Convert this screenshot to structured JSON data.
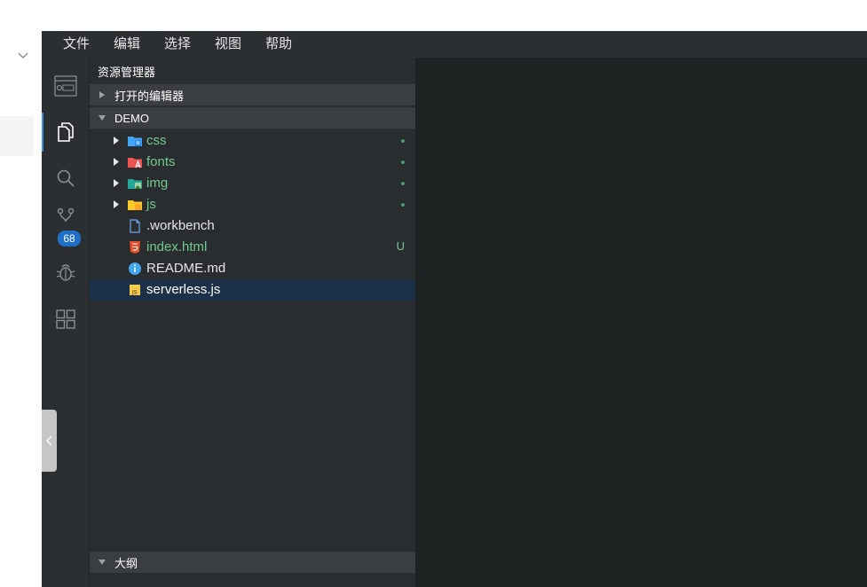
{
  "menu": [
    "文件",
    "编辑",
    "选择",
    "视图",
    "帮助"
  ],
  "activity": {
    "items": [
      {
        "name": "preview-icon"
      },
      {
        "name": "explorer-icon"
      },
      {
        "name": "search-icon"
      },
      {
        "name": "source-control-icon"
      },
      {
        "name": "debug-icon"
      },
      {
        "name": "extensions-icon"
      }
    ],
    "scm_badge": "68"
  },
  "sidebar": {
    "title": "资源管理器",
    "open_editors": "打开的编辑器",
    "workspace": "DEMO",
    "outline": "大纲",
    "tree": [
      {
        "name": "css",
        "type": "folder",
        "icon": "css-folder-icon",
        "modified_dot": true
      },
      {
        "name": "fonts",
        "type": "folder",
        "icon": "fonts-folder-icon",
        "modified_dot": true
      },
      {
        "name": "img",
        "type": "folder",
        "icon": "img-folder-icon",
        "modified_dot": true
      },
      {
        "name": "js",
        "type": "folder",
        "icon": "js-folder-icon",
        "modified_dot": true
      },
      {
        "name": ".workbench",
        "type": "file",
        "icon": "file-icon",
        "status": ""
      },
      {
        "name": "index.html",
        "type": "file",
        "icon": "html5-icon",
        "status": "U"
      },
      {
        "name": "README.md",
        "type": "file",
        "icon": "info-icon",
        "status": ""
      },
      {
        "name": "serverless.js",
        "type": "file",
        "icon": "js-file-icon",
        "status": "",
        "selected": true
      }
    ]
  },
  "colors": {
    "accent": "#3c8dde",
    "untracked_green": "#73c991",
    "badge_blue": "#1e6fc8"
  }
}
